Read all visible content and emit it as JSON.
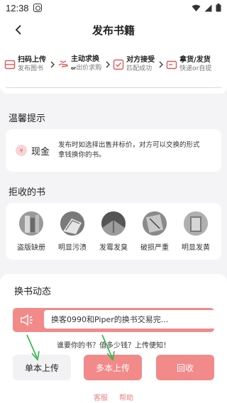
{
  "status_bar": {
    "time": "12:38"
  },
  "header": {
    "title": "发布书籍"
  },
  "steps": [
    {
      "title": "扫码上传",
      "sub": "发布图书",
      "or": ""
    },
    {
      "title": "主动求换",
      "sub": "出价求购",
      "or": "or"
    },
    {
      "title": "对方接受",
      "sub": "匹配成功",
      "or": ""
    },
    {
      "title": "拿货/发货",
      "sub": "快递or自提",
      "or": ""
    }
  ],
  "tips": {
    "section_title": "温馨提示",
    "icon_glyph": "¥",
    "label": "现金",
    "description": "发布时如选择出售并标价，对方可以交换的形式拿钱换你的书。"
  },
  "reject": {
    "section_title": "拒收的书",
    "items": [
      {
        "label": "盗版缺册"
      },
      {
        "label": "明显污渍"
      },
      {
        "label": "发霉发臭"
      },
      {
        "label": "破损严重"
      },
      {
        "label": "明显发黄"
      }
    ]
  },
  "exchange": {
    "title": "换书动态",
    "news": "换客0990和Piper的换书交易完...",
    "hint": "谁要你的书？值多少钱？上传便知！"
  },
  "buttons": {
    "single": "单本上传",
    "multi": "多本上传",
    "recycle": "回收"
  },
  "footer": {
    "service": "客服",
    "help": "帮助"
  },
  "colors": {
    "accent": "#f28a8a",
    "link": "#f08080",
    "arrow": "#2db84a"
  }
}
